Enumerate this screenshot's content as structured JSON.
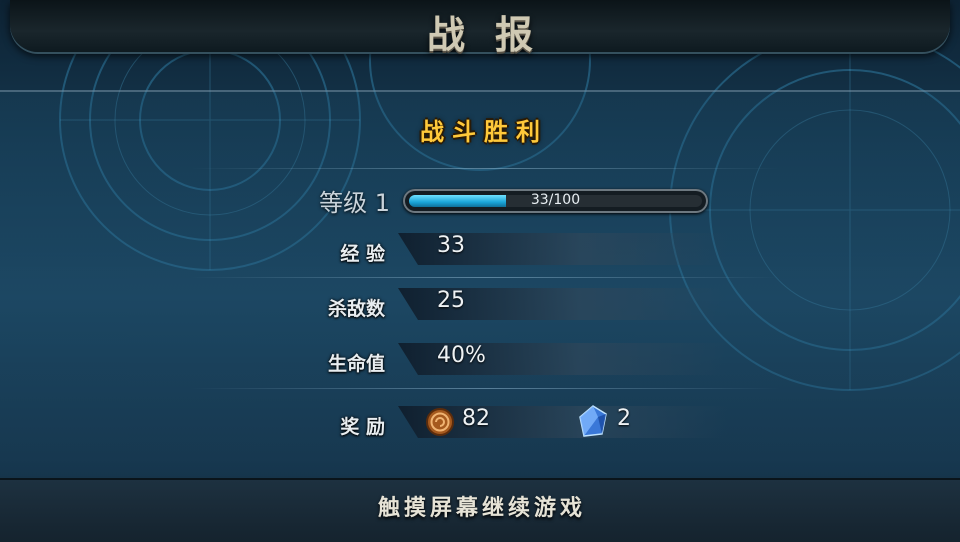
{
  "header": {
    "title": "战报"
  },
  "result": {
    "title": "战斗胜利"
  },
  "level": {
    "label": "等级 1",
    "xp_text": "33/100",
    "xp_progress": 0.33
  },
  "stats": [
    {
      "label": "经  验",
      "value": "33"
    },
    {
      "label": "杀敌数",
      "value": "25"
    },
    {
      "label": "生命值",
      "value": "40%"
    }
  ],
  "rewards": {
    "label": "奖  励",
    "coin": {
      "icon": "coin-icon",
      "value": "82"
    },
    "crystal": {
      "icon": "crystal-icon",
      "value": "2"
    }
  },
  "footer": {
    "prompt": "触摸屏幕继续游戏"
  }
}
